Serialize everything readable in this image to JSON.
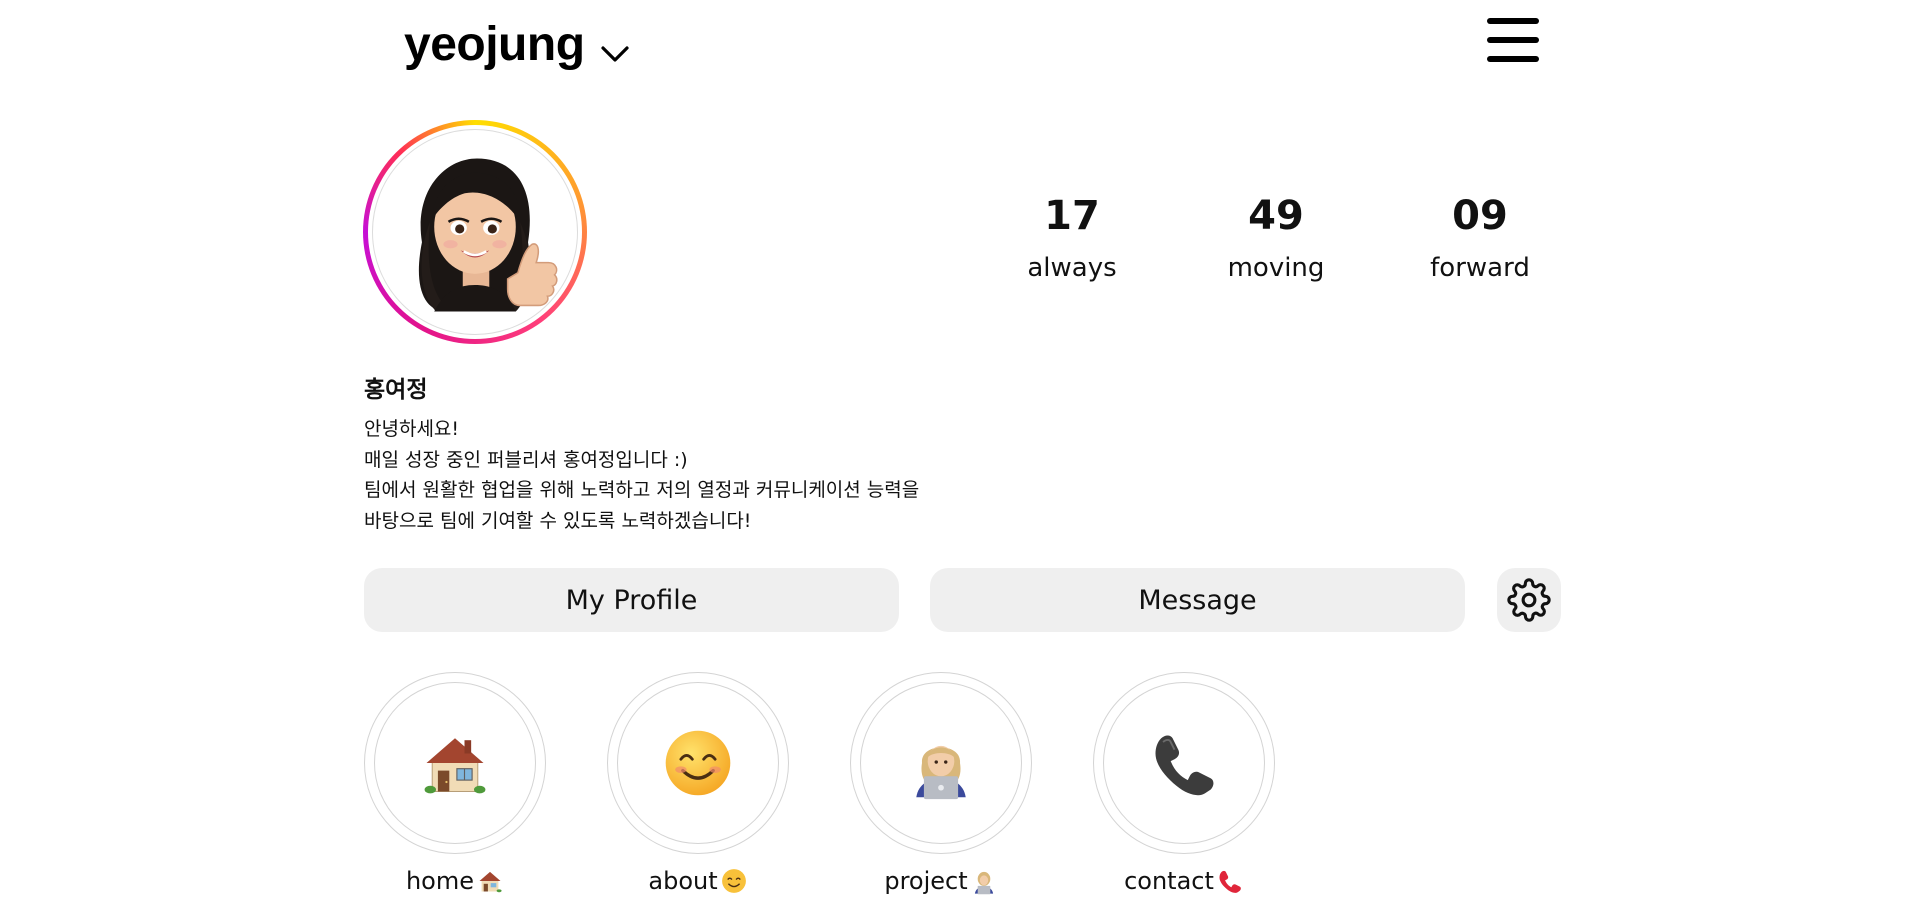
{
  "header": {
    "username": "yeojung",
    "account_switch_icon": "chevron-down-icon",
    "menu_icon": "hamburger-menu-icon"
  },
  "profile": {
    "avatar_icon": "memoji-thumbs-up-avatar",
    "stats": [
      {
        "value": "17",
        "label": "always"
      },
      {
        "value": "49",
        "label": "moving"
      },
      {
        "value": "09",
        "label": "forward"
      }
    ],
    "name": "홍여정",
    "bio": [
      "안녕하세요!",
      "매일 성장 중인 퍼블리셔 홍여정입니다 :)",
      "팀에서 원활한 협업을 위해 노력하고 저의 열정과 커뮤니케이션 능력을",
      "바탕으로 팀에 기여할 수 있도록 노력하겠습니다!"
    ]
  },
  "actions": {
    "profile_label": "My Profile",
    "message_label": "Message",
    "settings_icon": "gear-icon"
  },
  "highlights": [
    {
      "label": "home",
      "icon": "house-icon"
    },
    {
      "label": "about",
      "icon": "smiling-face-icon"
    },
    {
      "label": "project",
      "icon": "technologist-icon"
    },
    {
      "label": "contact",
      "icon": "telephone-receiver-icon"
    }
  ],
  "colors": {
    "story_ring": [
      "#ffde00",
      "#ff9b2f",
      "#ff3e7a",
      "#e2128b",
      "#c60fd6"
    ],
    "button_bg": "#efefef",
    "text": "#111111"
  }
}
